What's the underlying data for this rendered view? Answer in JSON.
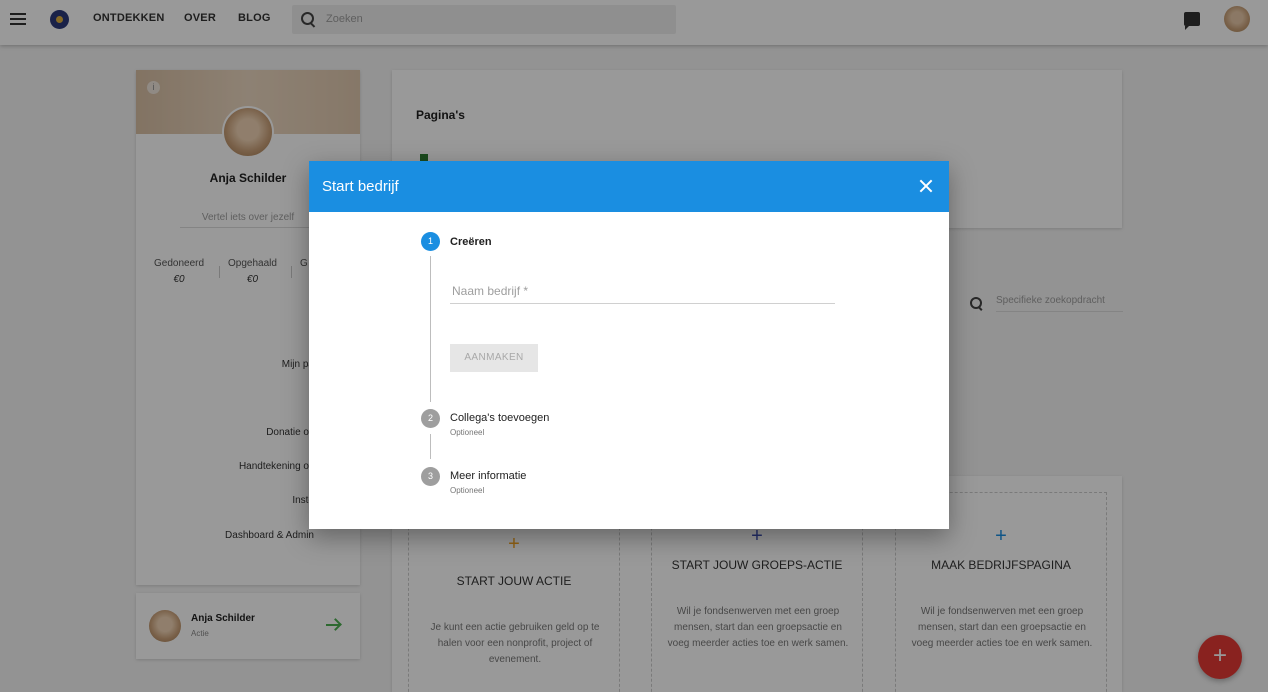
{
  "nav": {
    "links": [
      "ONTDEKKEN",
      "OVER",
      "BLOG"
    ],
    "search_placeholder": "Zoeken"
  },
  "profile": {
    "name": "Anja Schilder",
    "tagline_placeholder": "Vertel iets over jezelf",
    "stats": [
      {
        "label": "Gedoneerd",
        "value": "€0"
      },
      {
        "label": "Opgehaald",
        "value": "€0"
      },
      {
        "label": "G",
        "value": ""
      }
    ],
    "links": [
      "Mijn pa",
      "Donatie ov",
      "Handtekening ov",
      "Inste",
      "Dashboard & Admin"
    ]
  },
  "user_card": {
    "name": "Anja Schilder",
    "role": "Actie"
  },
  "pages": {
    "title": "Pagina's"
  },
  "specific_search": {
    "placeholder": "Specifieke zoekopdracht"
  },
  "actions": [
    {
      "title": "START JOUW ACTIE",
      "desc": "Je kunt een actie gebruiken geld op te halen voor een nonprofit, project of evenement.",
      "plus_color": "#f5a623"
    },
    {
      "title": "START JOUW GROEPS-ACTIE",
      "desc": "Wil je fondsenwerven met een groep mensen, start dan een groepsactie en voeg meerder acties toe en werk samen.",
      "plus_color": "#3f51b5"
    },
    {
      "title": "MAAK BEDRIJFSPAGINA",
      "desc": "Wil je fondsenwerven met een groep mensen, start dan een groepsactie en voeg meerder acties toe en werk samen.",
      "plus_color": "#1a8ee1"
    }
  ],
  "fab": {
    "label": "+"
  },
  "dialog": {
    "title": "Start bedrijf",
    "steps": [
      {
        "number": "1",
        "label": "Creëren",
        "sub": ""
      },
      {
        "number": "2",
        "label": "Collega's toevoegen",
        "sub": "Optioneel"
      },
      {
        "number": "3",
        "label": "Meer informatie",
        "sub": "Optioneel"
      }
    ],
    "field_label": "Naam bedrijf *",
    "create_button": "AANMAKEN"
  },
  "colors": {
    "primary": "#1a8ee1",
    "fab": "#e53935",
    "success": "#4caf50"
  }
}
